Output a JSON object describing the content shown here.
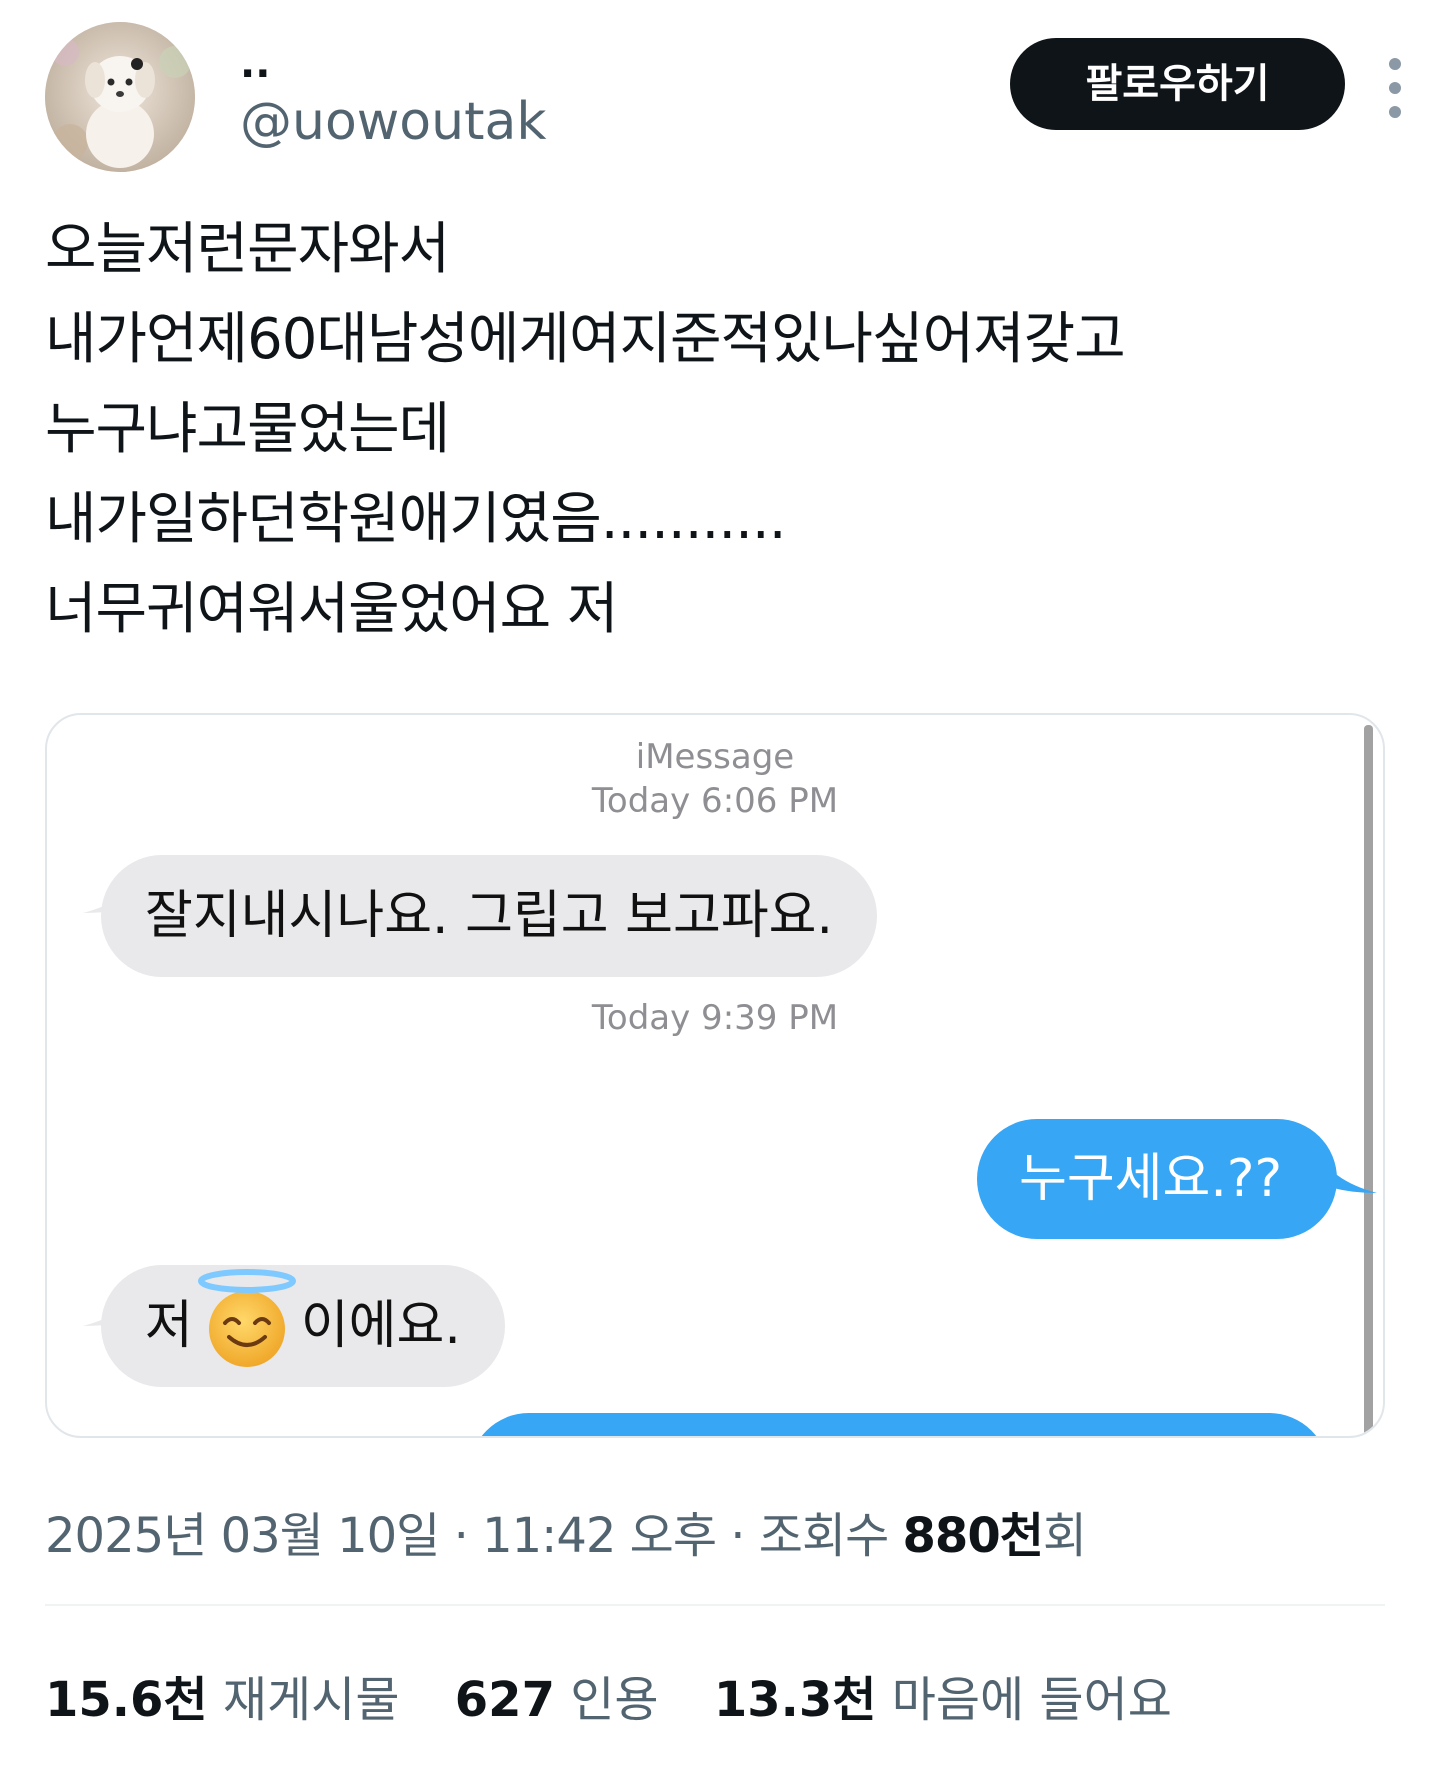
{
  "author": {
    "display_name": "..",
    "handle": "@uowoutak",
    "follow_label": "팔로우하기"
  },
  "tweet": {
    "lines": [
      "오늘저런문자와서",
      "내가언제60대남성에게여지준적있나싶어져갖고",
      "누구냐고물었는데",
      "내가일하던학원애기였음...........",
      "너무귀여워서울었어요 저"
    ]
  },
  "imessage": {
    "service": "iMessage",
    "time1": "Today 6:06 PM",
    "msg1": "잘지내시나요. 그립고 보고파요.",
    "time2": "Today 9:39 PM",
    "msg2": "누구세요.??",
    "msg3_before": "저",
    "msg3_emoji": "smiling-face-with-halo",
    "msg3_after": "이에요."
  },
  "meta": {
    "date": "2025년 03월 10일",
    "sep": " · ",
    "time": "11:42 오후",
    "views_label": "조회수 ",
    "views_num": "880천",
    "views_suffix": "회"
  },
  "stats": [
    {
      "num": "15.6천",
      "label": "재게시물"
    },
    {
      "num": "627",
      "label": "인용"
    },
    {
      "num": "13.3천",
      "label": "마음에 들어요"
    }
  ],
  "colors": {
    "incoming_bubble": "#e9e9eb",
    "outgoing_bubble": "#37a6f5",
    "follow_button": "#0f1419",
    "secondary_text": "#536471"
  }
}
